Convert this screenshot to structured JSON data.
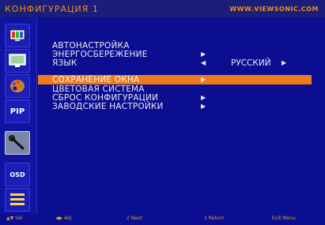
{
  "header": {
    "title": "КОНФИГУРАЦИЯ 1",
    "site": "WWW.VIEWSONIC.COM"
  },
  "sidebar": {
    "items": [
      {
        "icon": "tv-icon"
      },
      {
        "icon": "monitor-icon"
      },
      {
        "icon": "palette-icon"
      },
      {
        "icon": "pip-icon",
        "label": "PIP"
      },
      {
        "icon": "wrench-icon",
        "active": true
      },
      {
        "icon": "osd-icon",
        "label": "OSD"
      },
      {
        "icon": "list-menu-icon"
      }
    ]
  },
  "menu": {
    "items": [
      {
        "label": "АВТОНАСТРОЙКА"
      },
      {
        "label": "ЭНЕРГОСБЕРЕЖЕНИЕ",
        "arrow": "▶"
      },
      {
        "label": "ЯЗЫК",
        "arrow": "◀",
        "value": "РУССКИЙ",
        "arrow2": "▶"
      },
      {
        "label": "СОХРАНЕНИЕ ОКНА",
        "arrow": "▶",
        "selected": true
      },
      {
        "label": "ЦВЕТОВАЯ СИСТЕМА"
      },
      {
        "label": "СБРОС КОНФИГУРАЦИИ",
        "arrow": "▶"
      },
      {
        "label": "ЗАВОДСКИЕ НАСТРОЙКИ",
        "arrow": "▶"
      }
    ]
  },
  "footer": {
    "items": [
      "▲▼ Sel",
      "◀▶ Adj",
      "2 Next",
      "1 Return",
      "Exit Menu"
    ]
  },
  "colors": {
    "background": "#0c0e92",
    "highlight": "#ee7a1a",
    "title": "#e8901f",
    "footer_text": "#d6a521"
  }
}
